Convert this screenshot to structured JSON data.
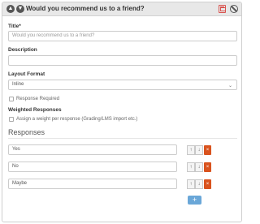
{
  "header": {
    "title": "Would you recommend us to a friend?",
    "icons": [
      "chevron-up-icon",
      "chevron-down-icon",
      "save-icon",
      "ban-icon"
    ],
    "accent": "#d9534f"
  },
  "form": {
    "title_label": "Title*",
    "title_value": "Would you recommend us to a friend?",
    "description_label": "Description",
    "description_value": "",
    "layout_label": "Layout Format",
    "layout_value": "Inline",
    "response_required_label": "Response Required",
    "response_required_checked": false,
    "weighted_label": "Weighted Responses",
    "assign_weight_label": "Assign a weight per response (Grading/LMS import etc.)",
    "assign_weight_checked": false
  },
  "responses": {
    "title": "Responses",
    "items": [
      {
        "value": "Yes"
      },
      {
        "value": "No"
      },
      {
        "value": "Maybe"
      }
    ],
    "remove_color": "#d9531e",
    "add_color": "#6aa7d8"
  }
}
